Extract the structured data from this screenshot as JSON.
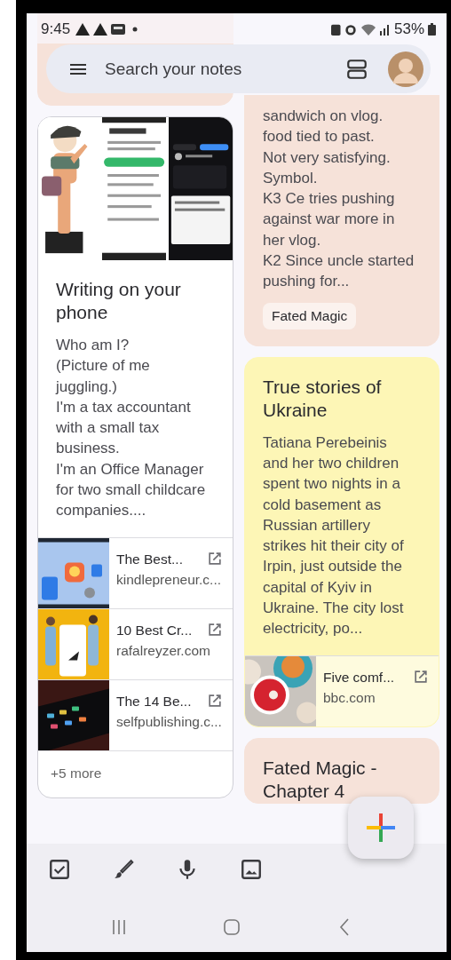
{
  "status_bar": {
    "time": "9:45",
    "battery": "53%"
  },
  "search": {
    "placeholder": "Search your notes"
  },
  "columns": [
    [
      {
        "color": "#f6e2d9"
      },
      {
        "color": "#ffffff",
        "title": "Writing on your phone",
        "body": "Who am I?\n(Picture of me juggling.)\nI'm a tax accountant with a small tax business.\nI'm an Office Manager for two small childcare companies....",
        "links": [
          {
            "title": "The Best...",
            "domain": "kindlepreneur.c..."
          },
          {
            "title": "10 Best Cr...",
            "domain": "rafalreyzer.com"
          },
          {
            "title": "The 14 Be...",
            "domain": "selfpublishing.c..."
          }
        ],
        "more": "+5 more"
      }
    ],
    [
      {
        "color": "#f6e2d9",
        "body": "sandwich on vlog.\nfood tied to past.\nNot very satisfying.\nSymbol.\nK3 Ce tries pushing against war more in her vlog.\nK2 Since uncle started pushing for...",
        "labels": [
          "Fated Magic"
        ]
      },
      {
        "color": "#fdf6b6",
        "title": "True stories of Ukraine",
        "body": "Tatiana Perebeinis and her two children spent two nights in a cold basement as Russian artillery strikes hit their city of Irpin, just outside the capital of Kyiv in Ukraine. The city lost electricity, po...",
        "links": [
          {
            "title": "Five comf...",
            "domain": "bbc.com"
          }
        ]
      },
      {
        "color": "#f6e2d9",
        "title": "Fated Magic - Chapter 4"
      }
    ]
  ]
}
